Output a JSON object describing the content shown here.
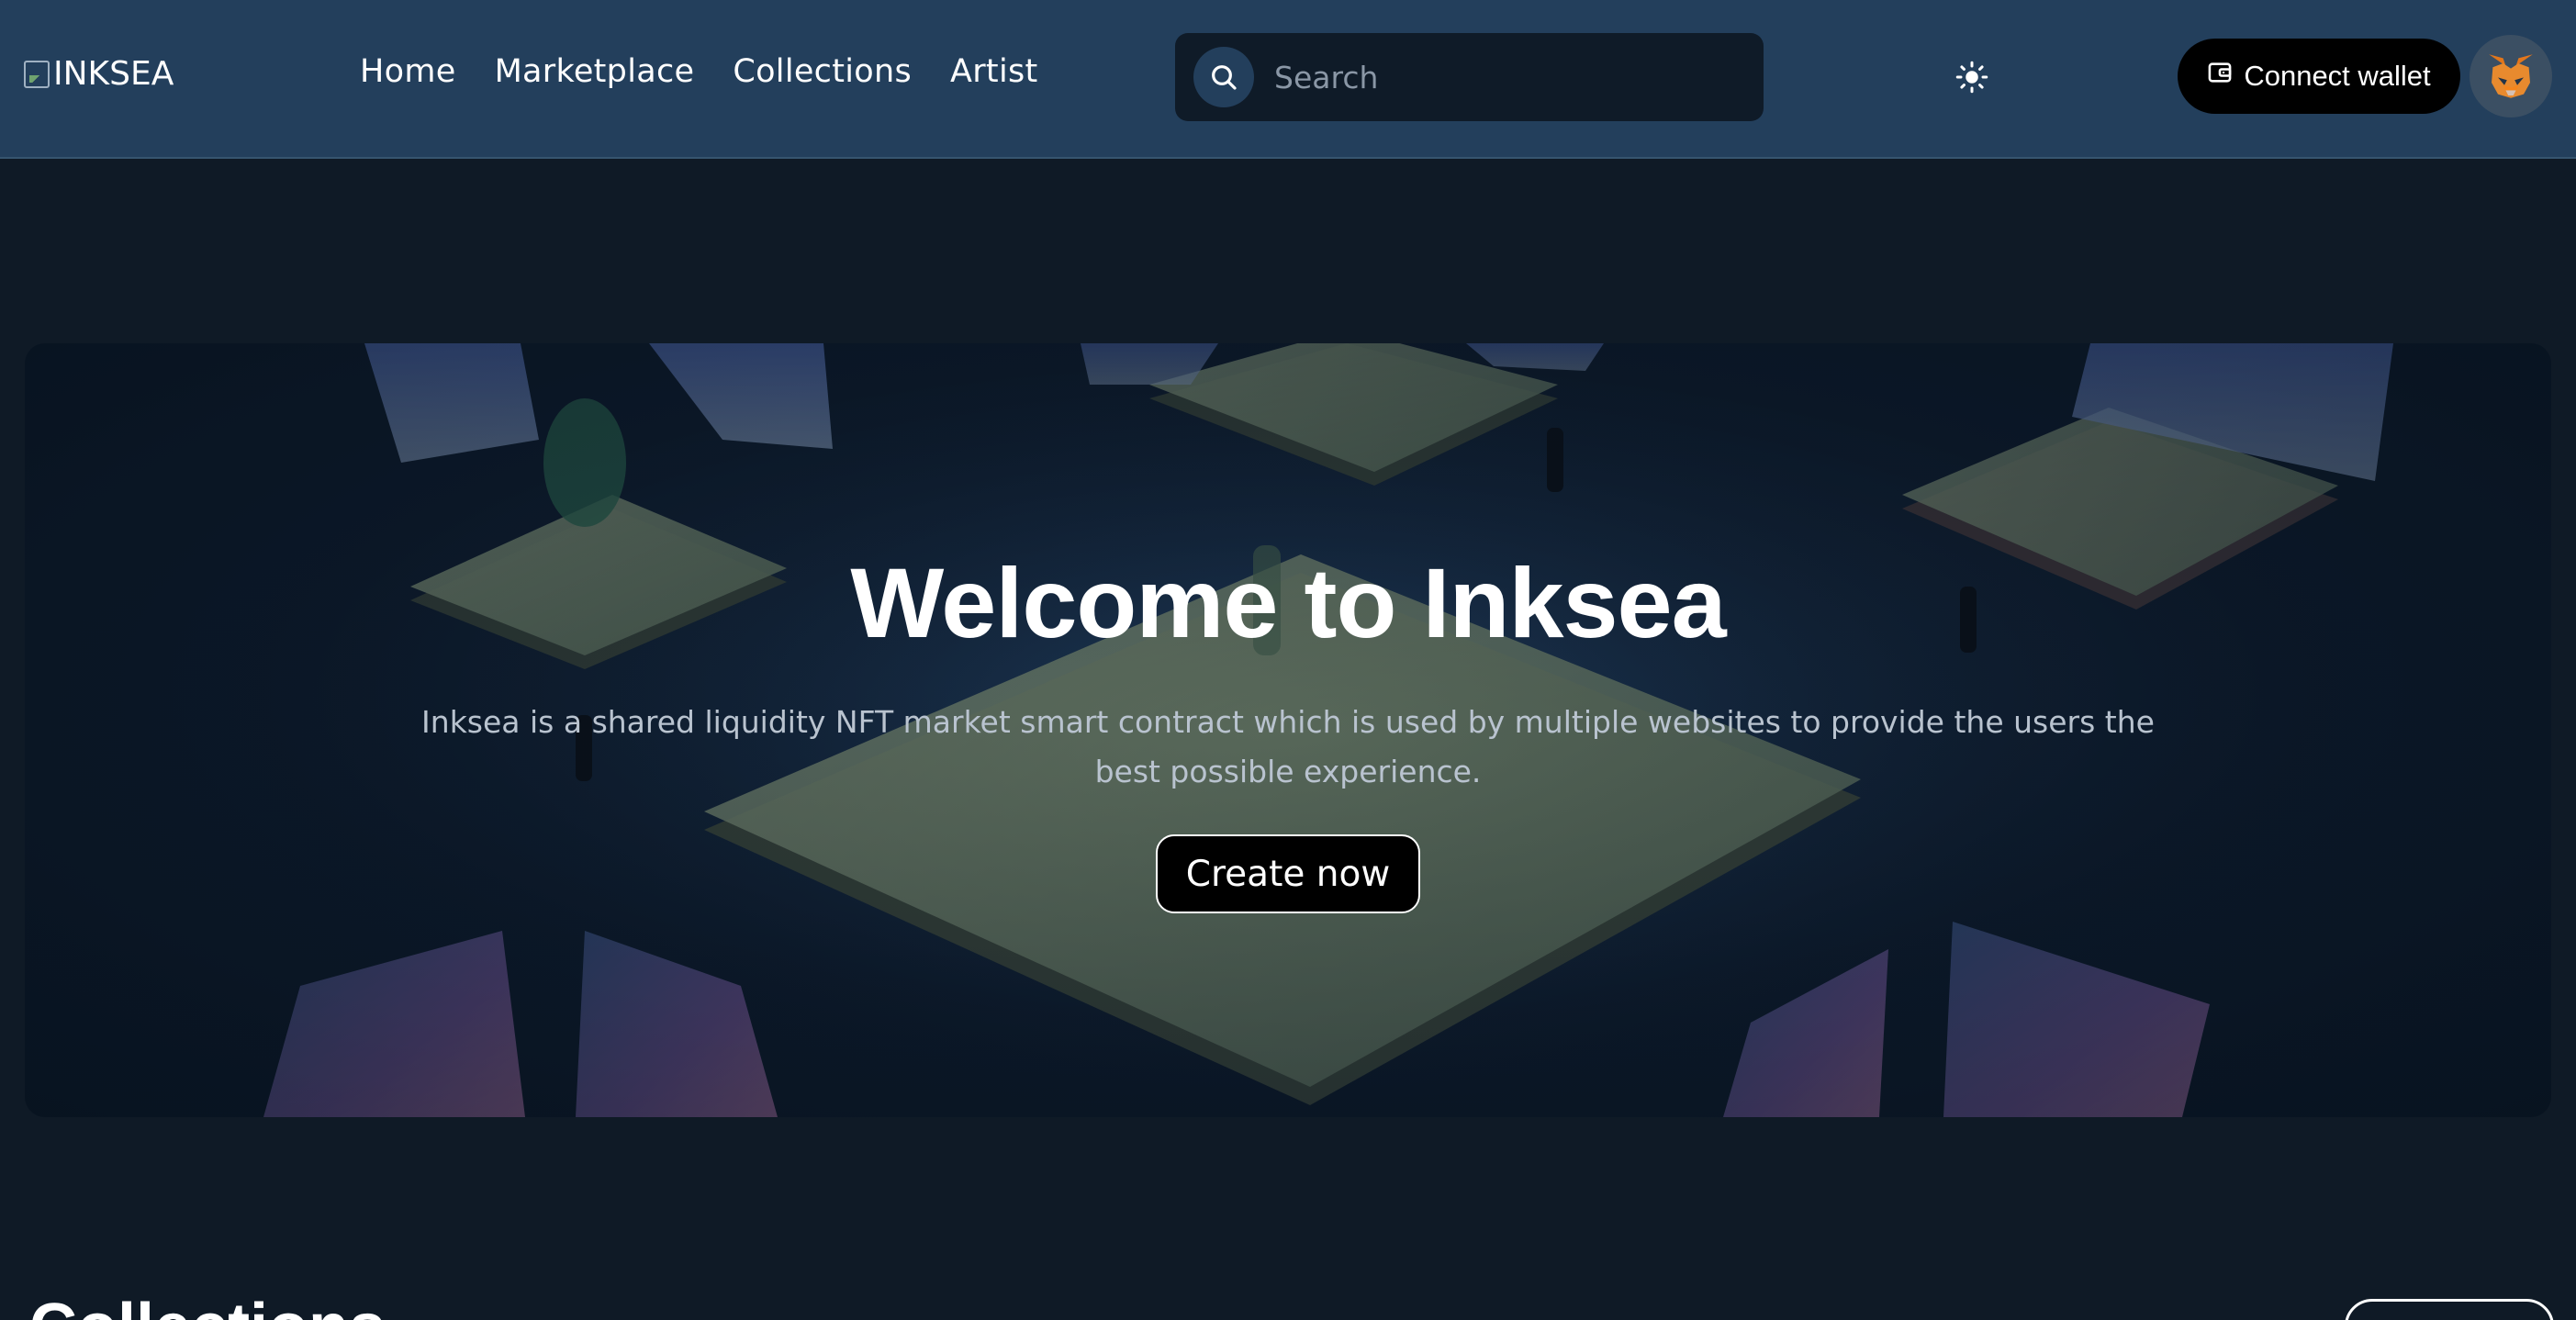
{
  "header": {
    "logo_alt": "INKSEA",
    "nav": [
      "Home",
      "Marketplace",
      "Collections",
      "Artist"
    ],
    "search_placeholder": "Search",
    "connect_label": "Connect wallet",
    "icons": {
      "search": "search-icon",
      "theme": "sun-icon",
      "wallet": "wallet-icon",
      "avatar": "metamask-fox-icon"
    }
  },
  "hero": {
    "title": "Welcome to Inksea",
    "subtitle": "Inksea is a shared liquidity NFT market smart contract which is used by multiple websites to provide the users the best possible experience.",
    "cta": "Create now"
  },
  "section": {
    "title": "Collections"
  },
  "colors": {
    "header_bg": "#233f5c",
    "page_bg": "#0f1a26",
    "search_bg": "#0f1b28",
    "button_bg": "#000000"
  }
}
